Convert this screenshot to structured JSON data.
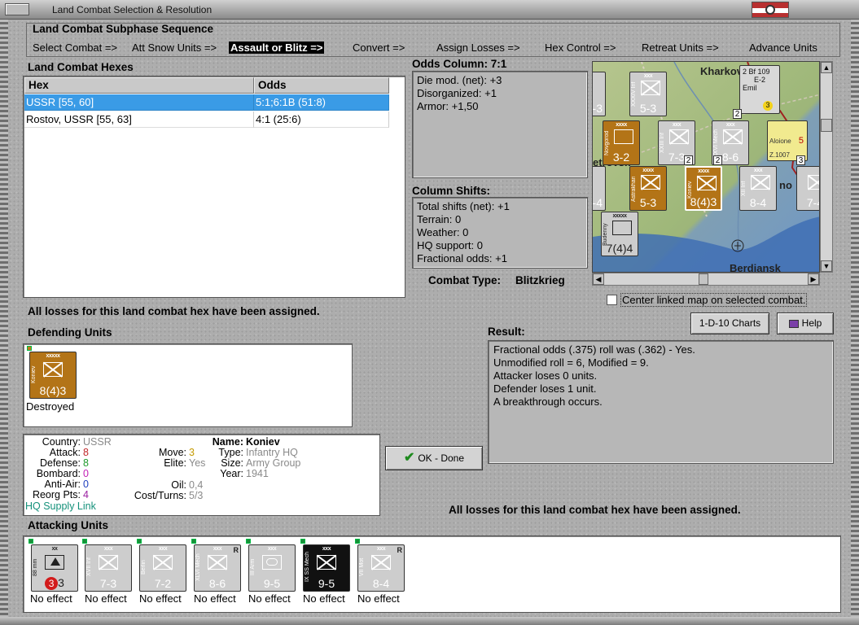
{
  "window": {
    "title": "Land Combat Selection & Resolution"
  },
  "phases": {
    "header": "Land Combat Subphase Sequence",
    "items": [
      "Select Combat =>",
      "Att Snow Units =>",
      "Assault or Blitz =>",
      "Convert =>",
      "Assign Losses =>",
      "Hex Control =>",
      "Retreat Units =>",
      "Advance Units"
    ],
    "active_index": 2
  },
  "hexes": {
    "label": "Land Combat Hexes",
    "col_hex": "Hex",
    "col_odds": "Odds",
    "rows": [
      {
        "hex": "USSR [55, 60]",
        "odds": "5:1;6:1B (51:8)"
      },
      {
        "hex": "Rostov, USSR [55, 63]",
        "odds": "4:1 (25:6)"
      }
    ]
  },
  "odds": {
    "label": "Odds Column: 7:1",
    "lines": [
      "Die mod. (net): +3",
      "Disorganized: +1",
      "Armor: +1,50"
    ]
  },
  "shifts": {
    "label": "Column Shifts:",
    "lines": [
      "Total shifts (net): +1",
      "Terrain: 0",
      "Weather: 0",
      "HQ support: 0",
      "Fractional odds: +1"
    ]
  },
  "combat_type": {
    "label": "Combat Type:",
    "value": "Blitzkrieg"
  },
  "map": {
    "cities": [
      "Kharkov",
      "Berdiansk"
    ],
    "partial": [
      "etrovsk",
      "no"
    ],
    "air": {
      "type": "Bf 109",
      "variant": "E-2",
      "name": "Emil",
      "val": "2",
      "num": "3"
    },
    "air2": {
      "name": "Aloione",
      "variant": "Z.1007",
      "num": "5"
    },
    "center_label": "Center linked map on selected combat."
  },
  "losses_msg": "All losses for this land combat hex have been assigned.",
  "defending": {
    "label": "Defending Units",
    "unit": {
      "echelon": "xxxxx",
      "name": "Koniev",
      "strength": "8(4)3",
      "status": "Destroyed"
    }
  },
  "buttons": {
    "charts": "1-D-10 Charts",
    "help": "Help",
    "ok": "OK - Done"
  },
  "result": {
    "label": "Result:",
    "lines": [
      "Fractional odds (.375) roll was (.362)  - Yes.",
      "Unmodified roll = 6, Modified = 9.",
      "Attacker loses 0 units.",
      "Defender loses 1 unit.",
      "A breakthrough occurs."
    ]
  },
  "details": {
    "country_k": "Country:",
    "country_v": "USSR",
    "attack_k": "Attack:",
    "attack_v": "8",
    "defense_k": "Defense:",
    "defense_v": "8",
    "bombard_k": "Bombard:",
    "bombard_v": "0",
    "antiair_k": "Anti-Air:",
    "antiair_v": "0",
    "reorg_k": "Reorg Pts:",
    "reorg_v": "4",
    "hq": "HQ Supply Link",
    "move_k": "Move:",
    "move_v": "3",
    "elite_k": "Elite:",
    "elite_v": "Yes",
    "oil_k": "Oil:",
    "oil_v": "0,4",
    "cost_k": "Cost/Turns:",
    "cost_v": "5/3",
    "name_k": "Name:",
    "name_v": "Koniev",
    "type_k": "Type:",
    "type_v": "Infantry HQ",
    "size_k": "Size:",
    "size_v": "Army Group",
    "year_k": "Year:",
    "year_v": "1941"
  },
  "attacking": {
    "label": "Attacking Units",
    "units": [
      {
        "echelon": "xx",
        "side": "88 mm",
        "str_a": "3",
        "str_b": "3",
        "status": "No effect",
        "color": "grey"
      },
      {
        "echelon": "xxx",
        "side": "XVII Inf",
        "strength": "7-3",
        "status": "No effect",
        "color": "grey"
      },
      {
        "echelon": "xxx",
        "side": "Berlin",
        "strength": "7-2",
        "status": "No effect",
        "color": "grey"
      },
      {
        "echelon": "xxx",
        "side": "XLVI Mech",
        "strength": "8-6",
        "status": "No effect",
        "color": "grey",
        "r": "R"
      },
      {
        "echelon": "xxx",
        "side": "III Arm",
        "strength": "9-5",
        "status": "No effect",
        "color": "grey"
      },
      {
        "echelon": "xxx",
        "side": "IX SS Mech",
        "strength": "9-5",
        "status": "No effect",
        "color": "black"
      },
      {
        "echelon": "xxx",
        "side": "VII Mot",
        "strength": "8-4",
        "status": "No effect",
        "color": "grey",
        "r": "R"
      }
    ]
  },
  "map_counters": [
    {
      "strength": "5-3",
      "echelon": "xxx",
      "side": "XXXIV Inf"
    },
    {
      "strength": "3-2",
      "echelon": "xxxx",
      "side": "Novgorod"
    },
    {
      "strength": "7-3",
      "echelon": "xxx",
      "side": "XXIII Inf"
    },
    {
      "strength": "8-6",
      "echelon": "xxx",
      "side": "XXVI Mech"
    },
    {
      "strength": "5-3",
      "echelon": "xxxx",
      "side": "Astrakhan"
    },
    {
      "strength": "8(4)3",
      "echelon": "xxxx",
      "side": "Koniev"
    },
    {
      "strength": "8-4",
      "echelon": "xxx",
      "side": "XII Inf"
    },
    {
      "strength": "7(4)4",
      "echelon": "xxxxx",
      "side": "Budenny"
    },
    {
      "strength": "-3",
      "echelon": "",
      "side": ""
    },
    {
      "strength": "-4",
      "echelon": "",
      "side": ""
    },
    {
      "strength": "7-4",
      "echelon": "",
      "side": ""
    }
  ],
  "map_stack_nums": [
    "2",
    "2",
    "3",
    "2"
  ]
}
